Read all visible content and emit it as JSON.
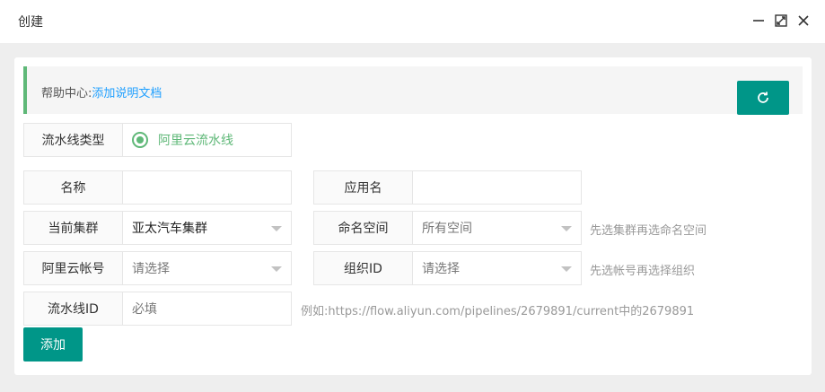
{
  "window": {
    "title": "创建"
  },
  "help": {
    "prefix": "帮助中心:",
    "link": "添加说明文档"
  },
  "pipeline_type": {
    "label": "流水线类型",
    "option": "阿里云流水线"
  },
  "name": {
    "label": "名称",
    "value": ""
  },
  "app_name": {
    "label": "应用名",
    "value": ""
  },
  "cluster": {
    "label": "当前集群",
    "value": "亚太汽车集群"
  },
  "namespace": {
    "label": "命名空间",
    "value": "所有空间",
    "hint": "先选集群再选命名空间"
  },
  "aliyun_account": {
    "label": "阿里云帐号",
    "value": "请选择"
  },
  "org_id": {
    "label": "组织ID",
    "value": "请选择",
    "hint": "先选帐号再选择组织"
  },
  "pipeline_id": {
    "label": "流水线ID",
    "placeholder": "必填",
    "hint": "例如:https://flow.aliyun.com/pipelines/2679891/current中的2679891"
  },
  "actions": {
    "add": "添加"
  },
  "colors": {
    "accent": "#009688",
    "green": "#5fb878",
    "link": "#1e9fff"
  },
  "icons": [
    "minimize-icon",
    "maximize-icon",
    "close-icon",
    "refresh-icon",
    "radio-checked-icon",
    "chevron-down-icon"
  ]
}
